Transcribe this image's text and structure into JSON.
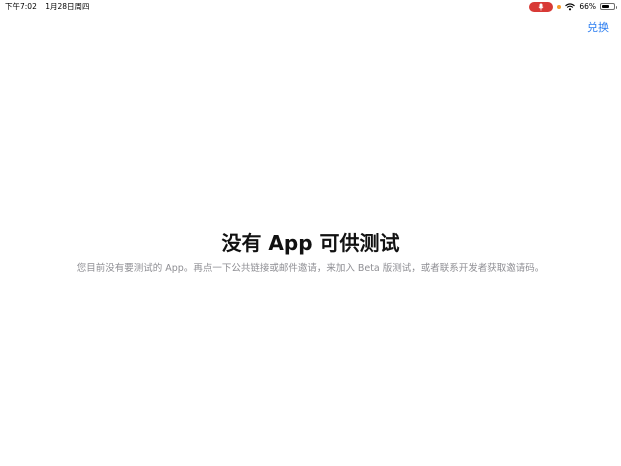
{
  "status_bar": {
    "time": "下午7:02",
    "date": "1月28日周四",
    "battery_percent": "66%",
    "battery_level": 0.66,
    "mic_indicator_color": "#d83a36",
    "privacy_dot_color": "#f59b2b",
    "icons": [
      "microphone-icon",
      "wifi-icon",
      "battery-icon"
    ]
  },
  "nav": {
    "redeem_label": "兑换",
    "accent_color": "#2b7df0"
  },
  "empty_state": {
    "title": "没有 App 可供测试",
    "description": "您目前没有要测试的 App。再点一下公共链接或邮件邀请，来加入 Beta 版测试，或者联系开发者获取邀请码。"
  }
}
